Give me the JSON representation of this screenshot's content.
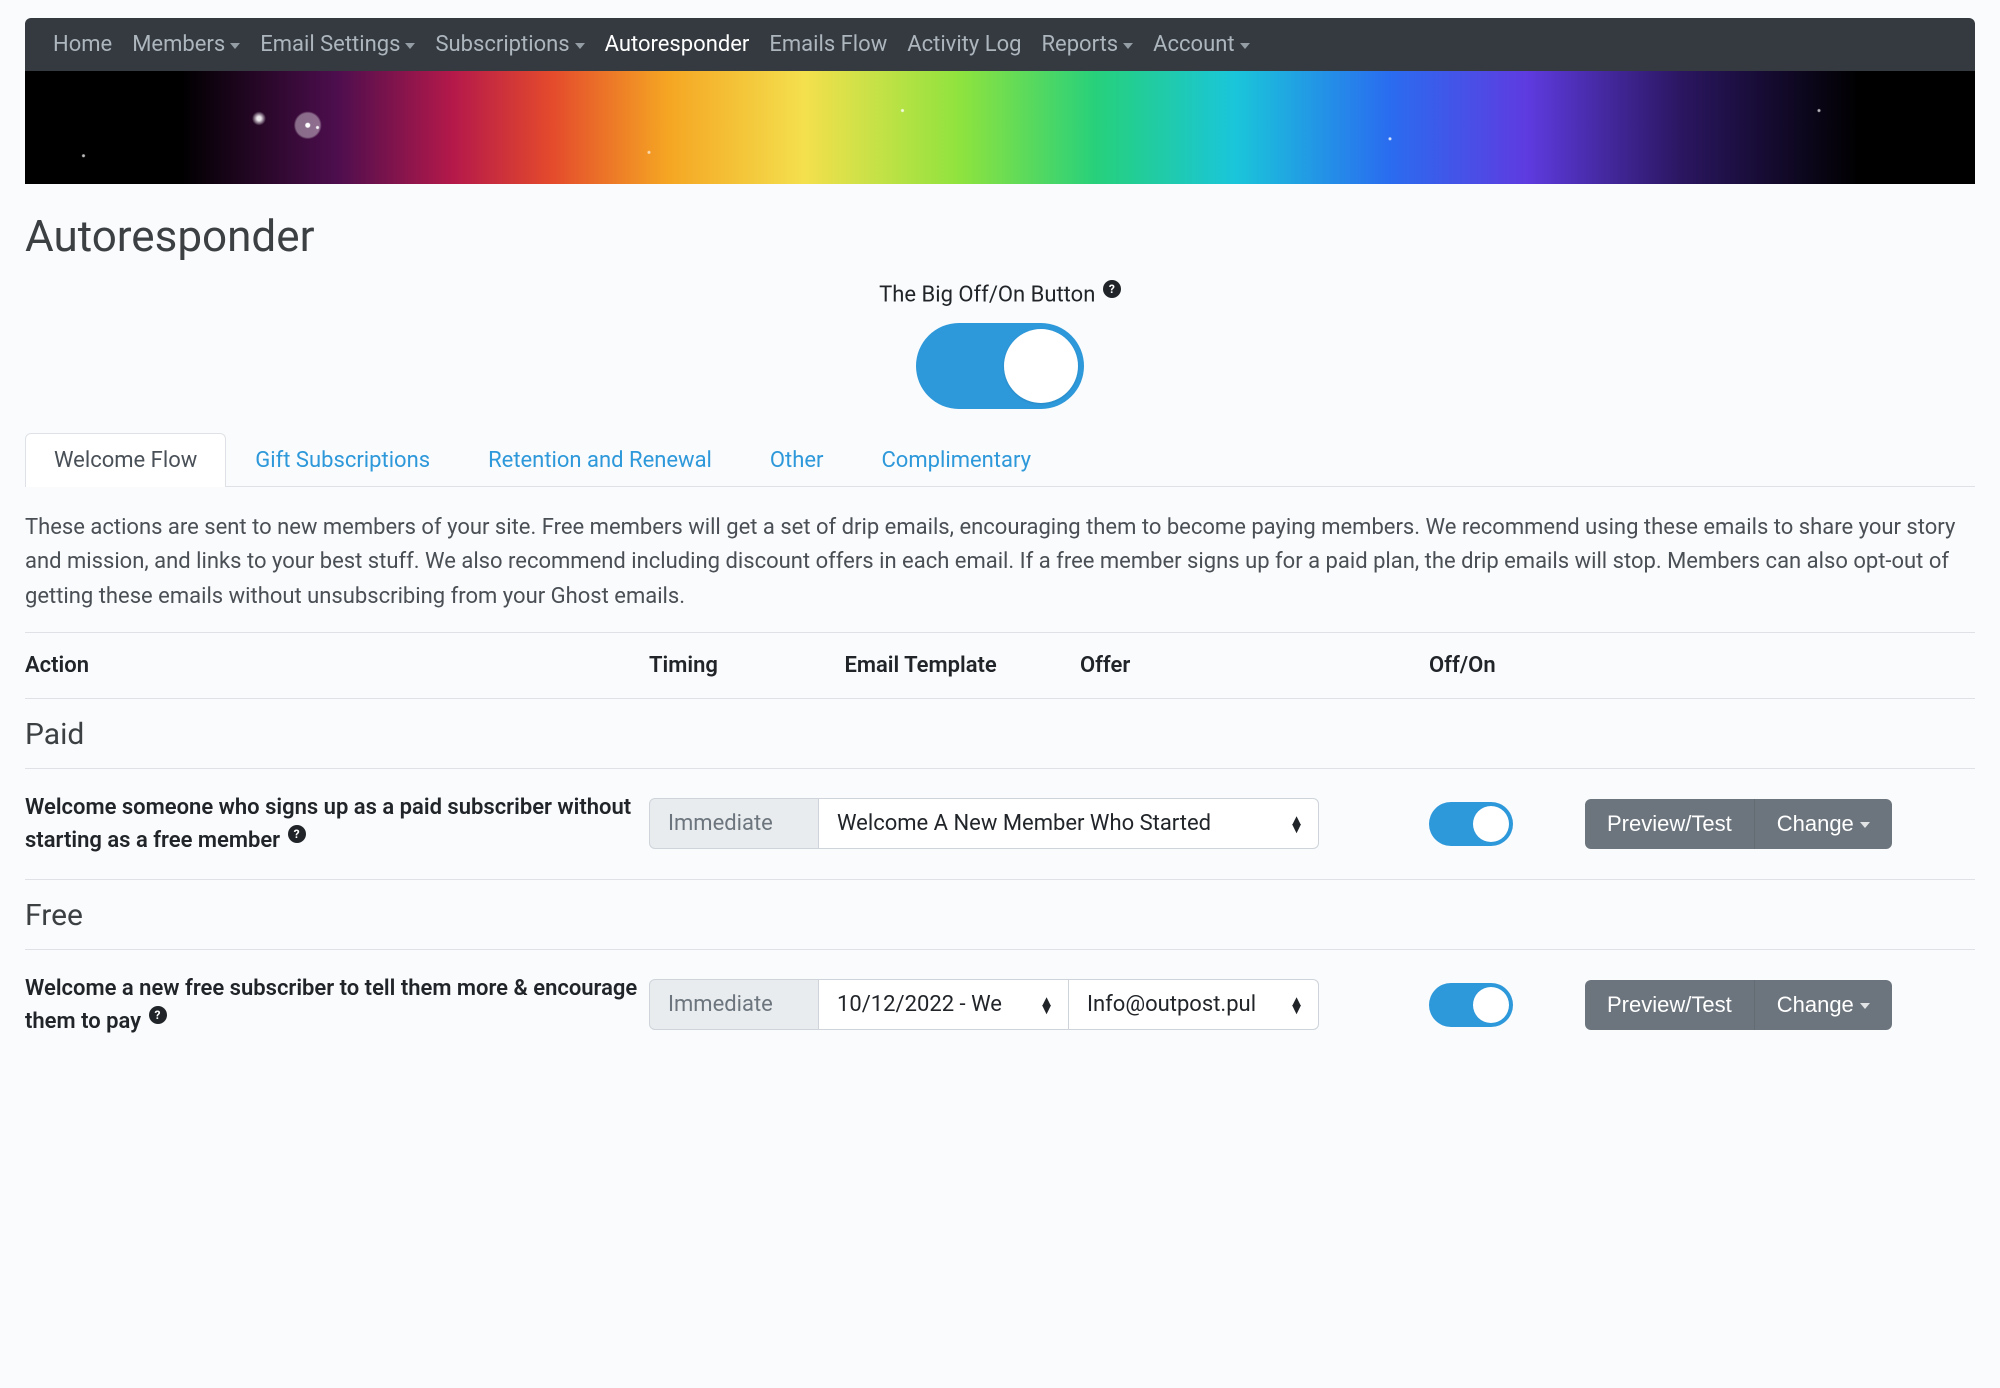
{
  "nav": {
    "items": [
      {
        "label": "Home",
        "dropdown": false,
        "active": false
      },
      {
        "label": "Members",
        "dropdown": true,
        "active": false
      },
      {
        "label": "Email Settings",
        "dropdown": true,
        "active": false
      },
      {
        "label": "Subscriptions",
        "dropdown": true,
        "active": false
      },
      {
        "label": "Autoresponder",
        "dropdown": false,
        "active": true
      },
      {
        "label": "Emails Flow",
        "dropdown": false,
        "active": false
      },
      {
        "label": "Activity Log",
        "dropdown": false,
        "active": false
      },
      {
        "label": "Reports",
        "dropdown": true,
        "active": false
      },
      {
        "label": "Account",
        "dropdown": true,
        "active": false
      }
    ]
  },
  "page_title": "Autoresponder",
  "big_toggle": {
    "label": "The Big Off/On Button",
    "help": "?",
    "on": true
  },
  "tabs": [
    {
      "label": "Welcome Flow",
      "active": true
    },
    {
      "label": "Gift Subscriptions",
      "active": false
    },
    {
      "label": "Retention and Renewal",
      "active": false
    },
    {
      "label": "Other",
      "active": false
    },
    {
      "label": "Complimentary",
      "active": false
    }
  ],
  "description": "These actions are sent to new members of your site. Free members will get a set of drip emails, encouraging them to become paying members. We recommend using these emails to share your story and mission, and links to your best stuff. We also recommend including discount offers in each email. If a free member signs up for a paid plan, the drip emails will stop. Members can also opt-out of getting these emails without unsubscribing from your Ghost emails.",
  "columns": {
    "action": "Action",
    "timing": "Timing",
    "email_template": "Email Template",
    "offer": "Offer",
    "offon": "Off/On"
  },
  "sections": {
    "paid": "Paid",
    "free": "Free"
  },
  "rows": {
    "paid_welcome": {
      "action": "Welcome someone who signs up as a paid subscriber without starting as a free member",
      "timing": "Immediate",
      "template": "Welcome A New Member Who Started",
      "offer": "",
      "on": true,
      "preview_label": "Preview/Test",
      "change_label": "Change"
    },
    "free_welcome": {
      "action": "Welcome a new free subscriber to tell them more & encourage them to pay",
      "timing": "Immediate",
      "template": "10/12/2022 - We",
      "offer": "Info@outpost.pul",
      "on": true,
      "preview_label": "Preview/Test",
      "change_label": "Change"
    }
  },
  "help_glyph": "?"
}
